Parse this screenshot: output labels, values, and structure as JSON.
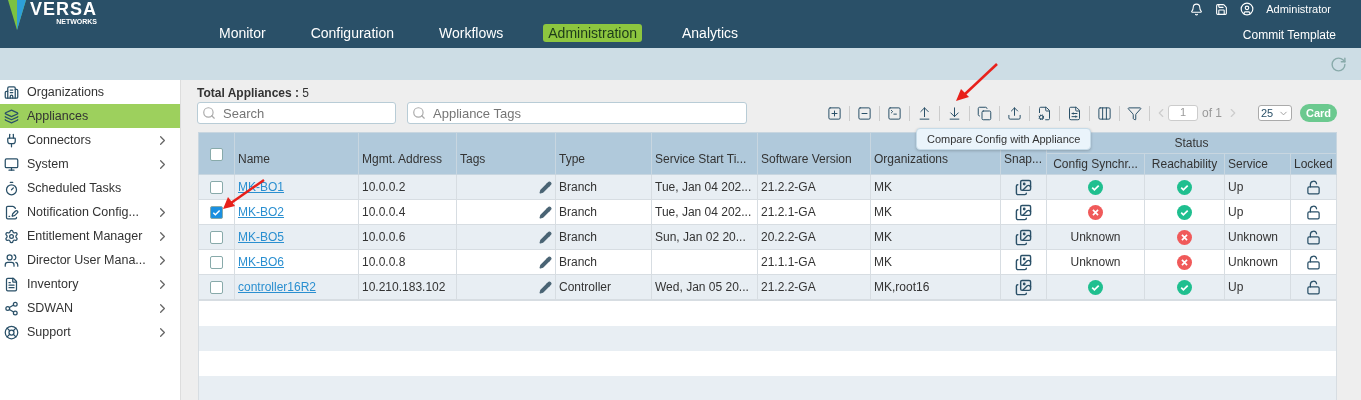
{
  "header": {
    "logo": {
      "name": "VERSA",
      "sub": "NETWORKS"
    },
    "user": "Administrator",
    "nav": [
      {
        "label": "Monitor",
        "selected": false
      },
      {
        "label": "Configuration",
        "selected": false
      },
      {
        "label": "Workflows",
        "selected": false
      },
      {
        "label": "Administration",
        "selected": true
      },
      {
        "label": "Analytics",
        "selected": false
      }
    ],
    "commit": "Commit Template"
  },
  "sidebar": {
    "items": [
      {
        "label": "Organizations",
        "selected": false,
        "expandable": false
      },
      {
        "label": "Appliances",
        "selected": true,
        "expandable": false
      },
      {
        "label": "Connectors",
        "selected": false,
        "expandable": true
      },
      {
        "label": "System",
        "selected": false,
        "expandable": true
      },
      {
        "label": "Scheduled Tasks",
        "selected": false,
        "expandable": false
      },
      {
        "label": "Notification Config...",
        "selected": false,
        "expandable": true
      },
      {
        "label": "Entitlement Manager",
        "selected": false,
        "expandable": true
      },
      {
        "label": "Director User Mana...",
        "selected": false,
        "expandable": true
      },
      {
        "label": "Inventory",
        "selected": false,
        "expandable": true
      },
      {
        "label": "SDWAN",
        "selected": false,
        "expandable": true
      },
      {
        "label": "Support",
        "selected": false,
        "expandable": true
      }
    ]
  },
  "main": {
    "total_label": "Total Appliances :",
    "total": "5",
    "search": {
      "placeholder": "Search"
    },
    "tags_search": {
      "placeholder": "Appliance Tags"
    },
    "toolbar": {
      "page": "1",
      "of": "of 1",
      "page_size": "25",
      "card": "Card"
    },
    "tooltip": "Compare Config with Appliance",
    "table": {
      "select_all": {
        "checked": false
      },
      "group": "Status",
      "columns": [
        "Name",
        "Mgmt. Address",
        "Tags",
        "Type",
        "Service Start Ti...",
        "Software Version",
        "Organizations",
        "Snap...",
        "Config Synchr...",
        "Reachability",
        "Service",
        "Locked"
      ],
      "rows": [
        {
          "checked": false,
          "name": "MK-BO1",
          "address": "10.0.0.2",
          "type": "Branch",
          "start": "Tue, Jan 04 202...",
          "version": "21.2.2-GA",
          "orgs": "MK",
          "sync": {
            "kind": "ok"
          },
          "reach": {
            "kind": "ok"
          },
          "service": "Up"
        },
        {
          "checked": true,
          "name": "MK-BO2",
          "address": "10.0.0.4",
          "type": "Branch",
          "start": "Tue, Jan 04 202...",
          "version": "21.2.1-GA",
          "orgs": "MK",
          "sync": {
            "kind": "error"
          },
          "reach": {
            "kind": "ok"
          },
          "service": "Up"
        },
        {
          "checked": false,
          "name": "MK-BO5",
          "address": "10.0.0.6",
          "type": "Branch",
          "start": "Sun, Jan 02 20...",
          "version": "20.2.2-GA",
          "orgs": "MK",
          "sync": {
            "kind": "text",
            "text": "Unknown"
          },
          "reach": {
            "kind": "error"
          },
          "service": "Unknown"
        },
        {
          "checked": false,
          "name": "MK-BO6",
          "address": "10.0.0.8",
          "type": "Branch",
          "version": "21.1.1-GA",
          "orgs": "MK",
          "sync": {
            "kind": "text",
            "text": "Unknown"
          },
          "reach": {
            "kind": "error"
          },
          "service": "Unknown"
        },
        {
          "checked": false,
          "name": "controller16R2",
          "address": "10.210.183.102",
          "type": "Controller",
          "start": "Wed, Jan 05 20...",
          "version": "21.2.2-GA",
          "orgs": "MK,root16",
          "sync": {
            "kind": "ok"
          },
          "reach": {
            "kind": "ok"
          },
          "service": "Up"
        }
      ]
    }
  }
}
